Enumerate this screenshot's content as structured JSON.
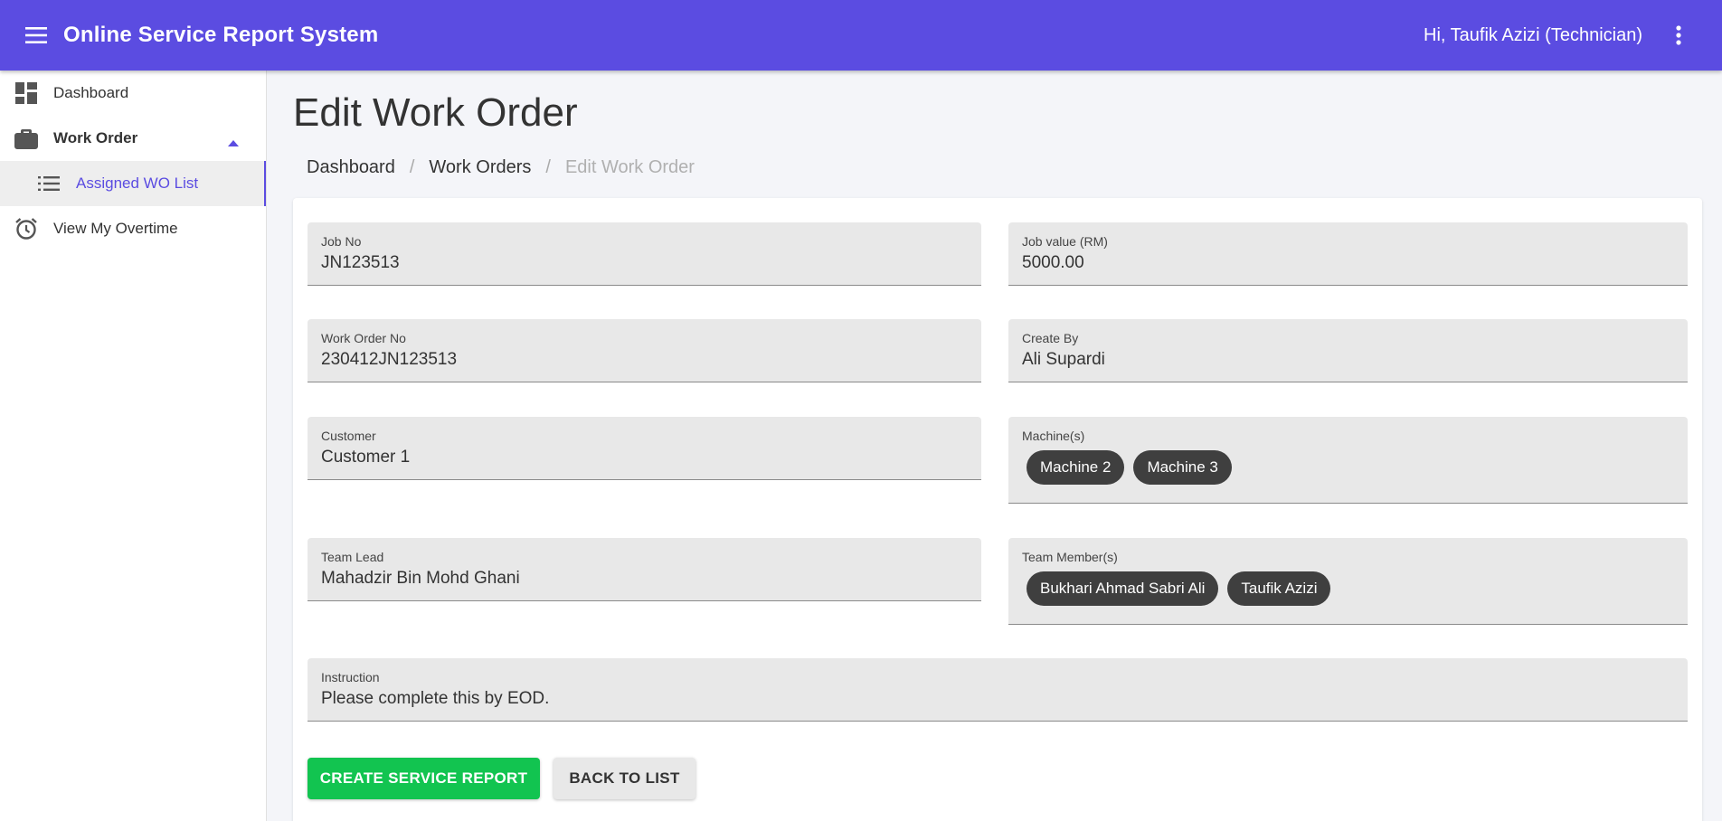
{
  "header": {
    "title": "Online Service Report System",
    "greeting": "Hi, Taufik Azizi (Technician)",
    "accent_color": "#5b4ce1"
  },
  "sidebar": {
    "items": [
      {
        "label": "Dashboard",
        "icon": "dashboard-icon"
      },
      {
        "label": "Work Order",
        "icon": "briefcase-icon",
        "expanded": true
      },
      {
        "label": "Assigned WO List",
        "icon": "list-icon",
        "active": true
      },
      {
        "label": "View My Overtime",
        "icon": "alarm-clock-icon"
      }
    ]
  },
  "page": {
    "title": "Edit Work Order",
    "breadcrumb": [
      "Dashboard",
      "Work Orders",
      "Edit Work Order"
    ]
  },
  "form": {
    "job_no": {
      "label": "Job No",
      "value": "JN123513"
    },
    "job_value": {
      "label": "Job value (RM)",
      "value": "5000.00"
    },
    "work_order_no": {
      "label": "Work Order No",
      "value": "230412JN123513"
    },
    "create_by": {
      "label": "Create By",
      "value": "Ali Supardi"
    },
    "customer": {
      "label": "Customer",
      "value": "Customer 1"
    },
    "machines": {
      "label": "Machine(s)",
      "chips": [
        "Machine 2",
        "Machine 3"
      ]
    },
    "team_lead": {
      "label": "Team Lead",
      "value": "Mahadzir Bin Mohd Ghani"
    },
    "team_members": {
      "label": "Team Member(s)",
      "chips": [
        "Bukhari Ahmad Sabri Ali",
        "Taufik Azizi"
      ]
    },
    "instruction": {
      "label": "Instruction",
      "value": "Please complete this by EOD."
    }
  },
  "actions": {
    "create_label": "CREATE SERVICE REPORT",
    "back_label": "BACK TO LIST",
    "create_color": "#12c450"
  }
}
